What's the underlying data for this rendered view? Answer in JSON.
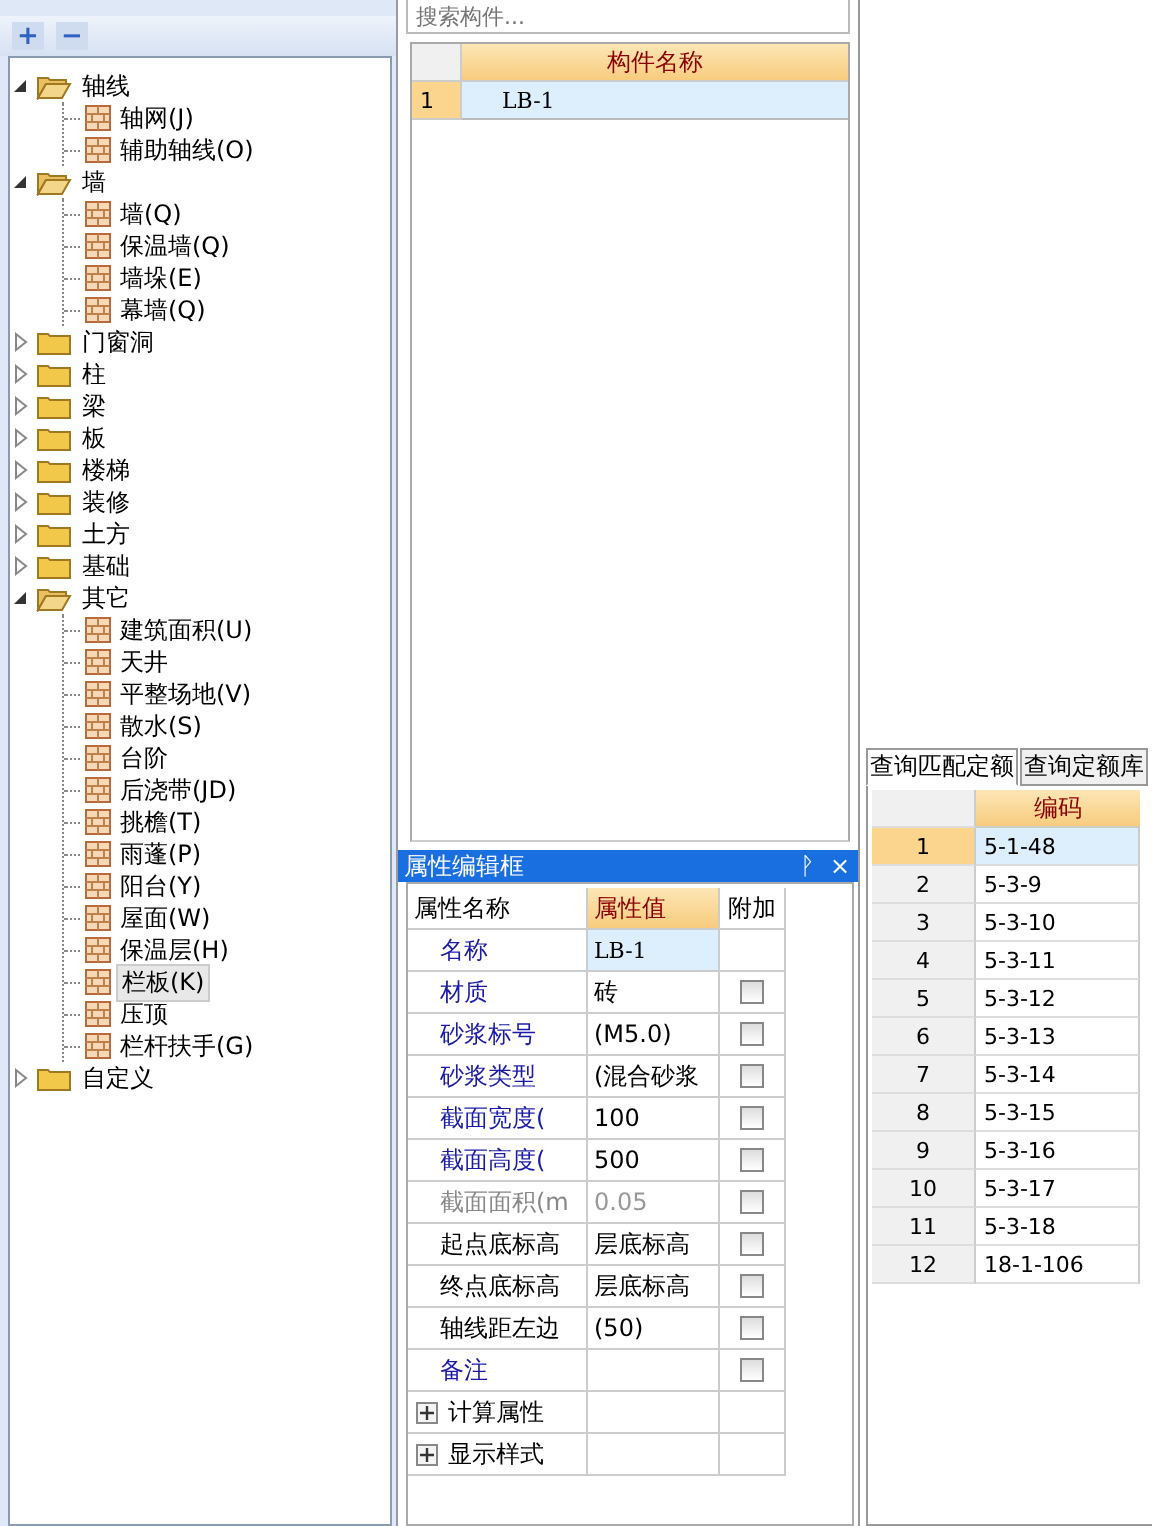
{
  "tree_toolbar": {
    "add": "+",
    "remove": "−"
  },
  "tree": [
    {
      "label": "轴线",
      "expanded": true,
      "children": [
        {
          "label": "轴网(J)",
          "selected": false
        },
        {
          "label": "辅助轴线(O)",
          "selected": false
        }
      ]
    },
    {
      "label": "墙",
      "expanded": true,
      "children": [
        {
          "label": "墙(Q)",
          "selected": false
        },
        {
          "label": "保温墙(Q)",
          "selected": false
        },
        {
          "label": "墙垛(E)",
          "selected": false
        },
        {
          "label": "幕墙(Q)",
          "selected": false
        }
      ]
    },
    {
      "label": "门窗洞",
      "expanded": false
    },
    {
      "label": "柱",
      "expanded": false
    },
    {
      "label": "梁",
      "expanded": false
    },
    {
      "label": "板",
      "expanded": false
    },
    {
      "label": "楼梯",
      "expanded": false
    },
    {
      "label": "装修",
      "expanded": false
    },
    {
      "label": "土方",
      "expanded": false
    },
    {
      "label": "基础",
      "expanded": false
    },
    {
      "label": "其它",
      "expanded": true,
      "children": [
        {
          "label": "建筑面积(U)",
          "selected": false
        },
        {
          "label": "天井",
          "selected": false
        },
        {
          "label": "平整场地(V)",
          "selected": false
        },
        {
          "label": "散水(S)",
          "selected": false
        },
        {
          "label": "台阶",
          "selected": false
        },
        {
          "label": "后浇带(JD)",
          "selected": false
        },
        {
          "label": "挑檐(T)",
          "selected": false
        },
        {
          "label": "雨蓬(P)",
          "selected": false
        },
        {
          "label": "阳台(Y)",
          "selected": false
        },
        {
          "label": "屋面(W)",
          "selected": false
        },
        {
          "label": "保温层(H)",
          "selected": false
        },
        {
          "label": "栏板(K)",
          "selected": true
        },
        {
          "label": "压顶",
          "selected": false
        },
        {
          "label": "栏杆扶手(G)",
          "selected": false
        }
      ]
    },
    {
      "label": "自定义",
      "expanded": false
    }
  ],
  "search": {
    "placeholder": "搜索构件..."
  },
  "component_table": {
    "columns": [
      "构件名称"
    ],
    "rows": [
      {
        "number": "1",
        "name": "LB-1",
        "selected": true
      }
    ]
  },
  "properties": {
    "title": "属性编辑框",
    "pin": "ᚹ",
    "close": "×",
    "columns": [
      "属性名称",
      "属性值",
      "附加"
    ],
    "rows": [
      {
        "kind": "public",
        "name": "名称",
        "value": "LB-1",
        "has_checkbox": false
      },
      {
        "kind": "public",
        "name": "材质",
        "value": "砖",
        "has_checkbox": true,
        "checked": false
      },
      {
        "kind": "public",
        "name": "砂浆标号",
        "value": "(M5.0)",
        "has_checkbox": true,
        "checked": false
      },
      {
        "kind": "public",
        "name": "砂浆类型",
        "value": "(混合砂浆",
        "has_checkbox": true,
        "checked": false
      },
      {
        "kind": "public",
        "name": "截面宽度(",
        "value": "100",
        "has_checkbox": true,
        "checked": false
      },
      {
        "kind": "public",
        "name": "截面高度(",
        "value": "500",
        "has_checkbox": true,
        "checked": false
      },
      {
        "kind": "computed",
        "name": "截面面积(m",
        "value": "0.05",
        "has_checkbox": true,
        "checked": false
      },
      {
        "kind": "private",
        "name": "起点底标高",
        "value": "层底标高",
        "has_checkbox": true,
        "checked": false
      },
      {
        "kind": "private",
        "name": "终点底标高",
        "value": "层底标高",
        "has_checkbox": true,
        "checked": false
      },
      {
        "kind": "private",
        "name": "轴线距左边",
        "value": "(50)",
        "has_checkbox": true,
        "checked": false
      },
      {
        "kind": "public",
        "name": "备注",
        "value": "",
        "has_checkbox": true,
        "checked": false
      },
      {
        "kind": "group",
        "name": "计算属性",
        "expanded": false
      },
      {
        "kind": "group",
        "name": "显示样式",
        "expanded": false
      }
    ]
  },
  "quota_tabs": [
    {
      "label": "查询匹配定额",
      "selected": true
    },
    {
      "label": "查询定额库",
      "selected": false
    }
  ],
  "quota_table": {
    "columns": [
      "编码"
    ],
    "rows": [
      {
        "number": "1",
        "code": "5-1-48",
        "selected": true
      },
      {
        "number": "2",
        "code": "5-3-9",
        "selected": false
      },
      {
        "number": "3",
        "code": "5-3-10",
        "selected": false
      },
      {
        "number": "4",
        "code": "5-3-11",
        "selected": false
      },
      {
        "number": "5",
        "code": "5-3-12",
        "selected": false
      },
      {
        "number": "6",
        "code": "5-3-13",
        "selected": false
      },
      {
        "number": "7",
        "code": "5-3-14",
        "selected": false
      },
      {
        "number": "8",
        "code": "5-3-15",
        "selected": false
      },
      {
        "number": "9",
        "code": "5-3-16",
        "selected": false
      },
      {
        "number": "10",
        "code": "5-3-17",
        "selected": false
      },
      {
        "number": "11",
        "code": "5-3-18",
        "selected": false
      },
      {
        "number": "12",
        "code": "18-1-106",
        "selected": false
      }
    ]
  }
}
